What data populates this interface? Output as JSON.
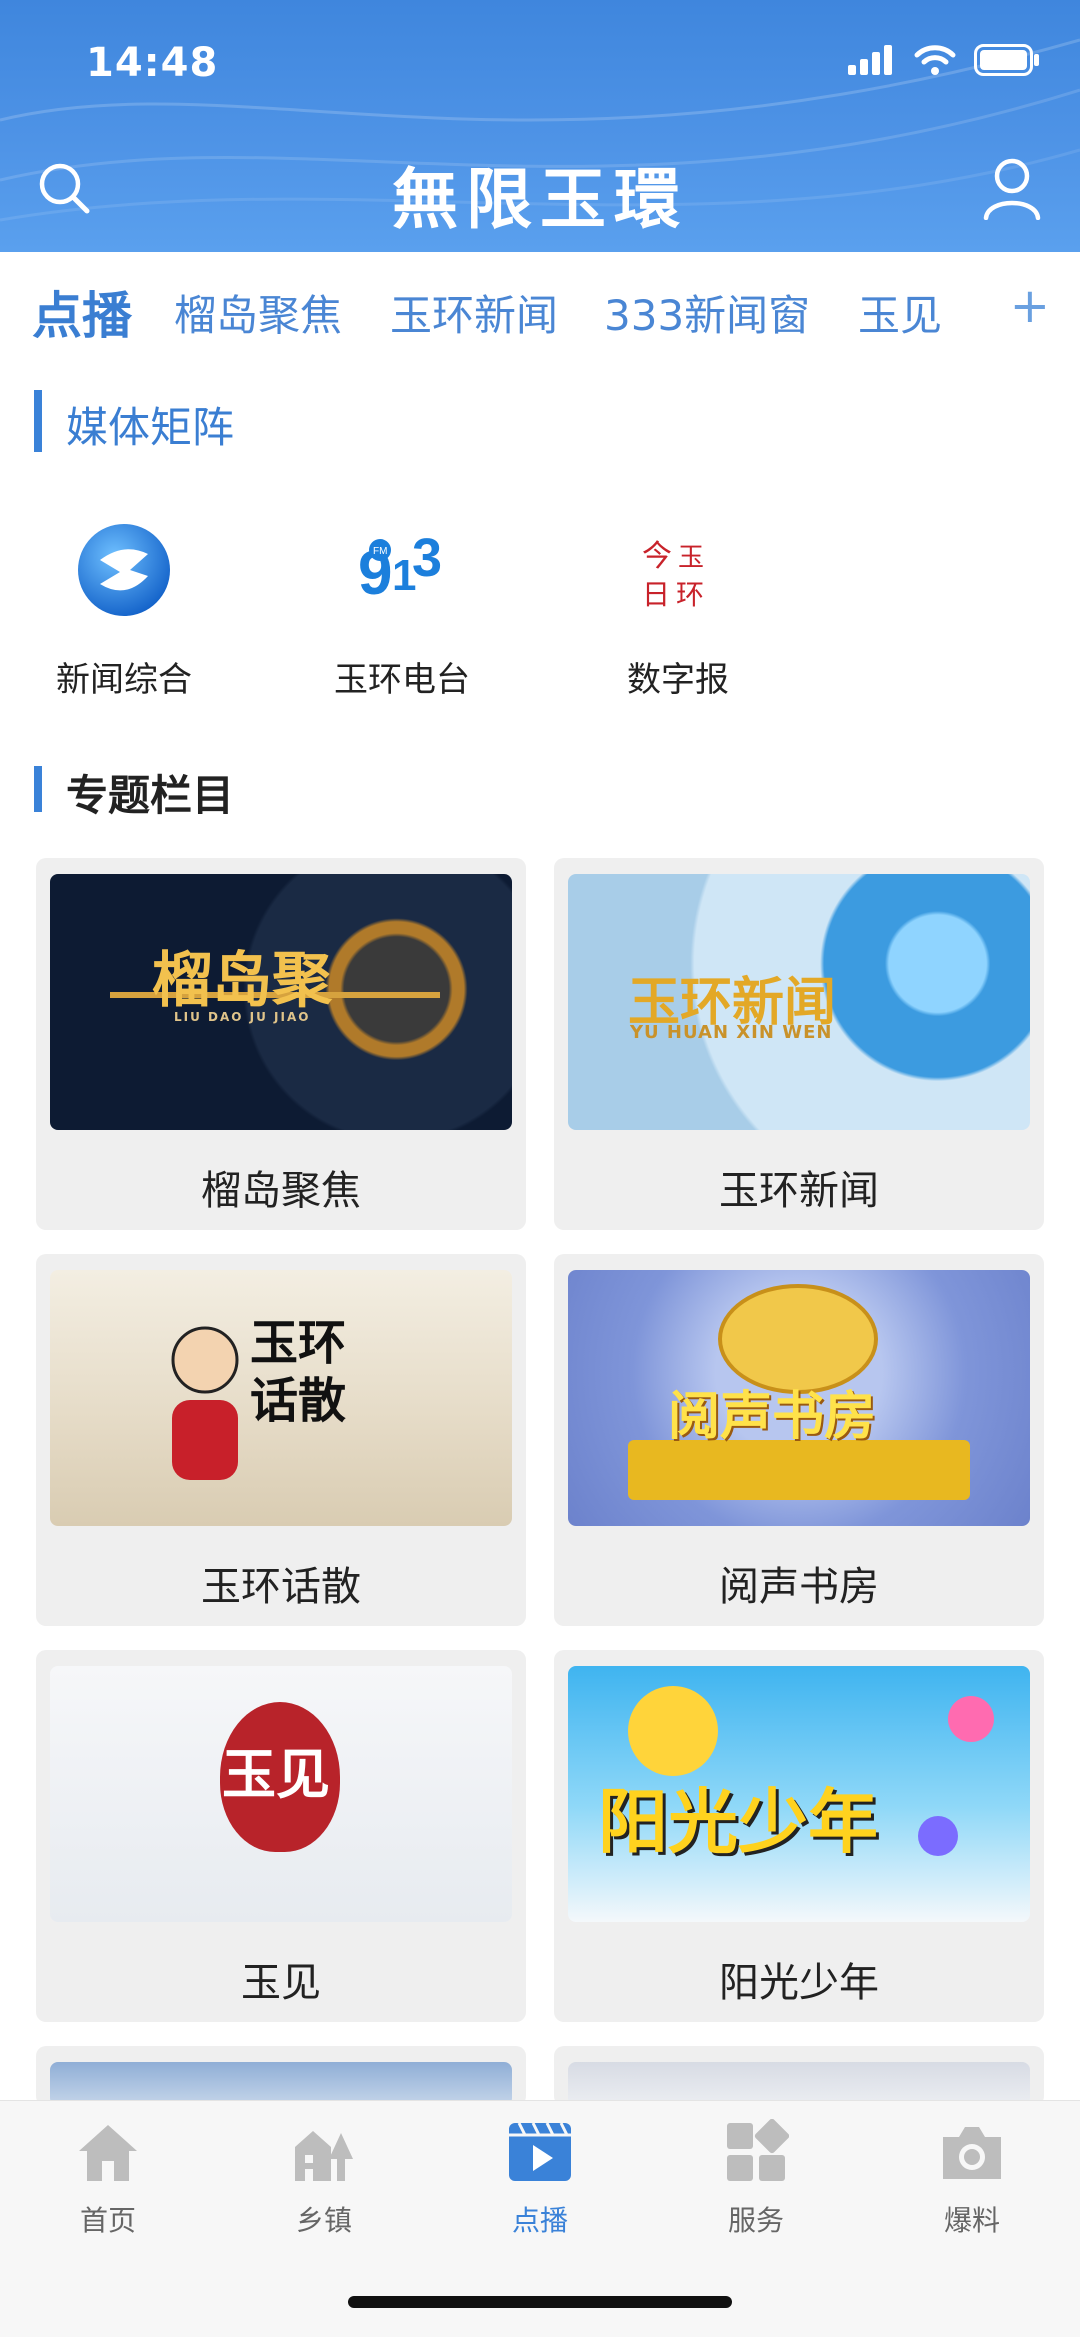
{
  "status": {
    "time": "14:48"
  },
  "header": {
    "title": "無限玉環"
  },
  "tabs": [
    "点播",
    "榴岛聚焦",
    "玉环新闻",
    "333新闻窗",
    "玉见"
  ],
  "tabs_more": "+",
  "media_section": {
    "title": "媒体矩阵",
    "items": [
      {
        "label": "新闻综合",
        "icon": "news-channel-icon"
      },
      {
        "label": "玉环电台",
        "icon": "radio-fm-icon"
      },
      {
        "label": "数字报",
        "icon": "digital-newspaper-icon"
      }
    ]
  },
  "topics_section": {
    "title": "专题栏目",
    "cards": [
      {
        "label": "榴岛聚焦",
        "thumb_text": "榴岛聚",
        "thumb_sub": "LIU DAO JU JIAO"
      },
      {
        "label": "玉环新闻",
        "thumb_text": "玉环新闻",
        "thumb_sub": "YU HUAN XIN WEN"
      },
      {
        "label": "玉环话散",
        "thumb_text": "玉环话散"
      },
      {
        "label": "阅声书房",
        "thumb_text": "阅声书房"
      },
      {
        "label": "玉见",
        "thumb_text": "玉见"
      },
      {
        "label": "阳光少年",
        "thumb_text": "阳光少年"
      }
    ]
  },
  "bottom_nav": [
    {
      "label": "首页",
      "icon": "home-icon"
    },
    {
      "label": "乡镇",
      "icon": "town-icon"
    },
    {
      "label": "点播",
      "icon": "video-play-icon",
      "active": true
    },
    {
      "label": "服务",
      "icon": "services-icon"
    },
    {
      "label": "爆料",
      "icon": "camera-icon"
    }
  ],
  "colors": {
    "accent": "#3a82d8",
    "header": "#4a8fe3",
    "card_bg": "#efefef"
  }
}
